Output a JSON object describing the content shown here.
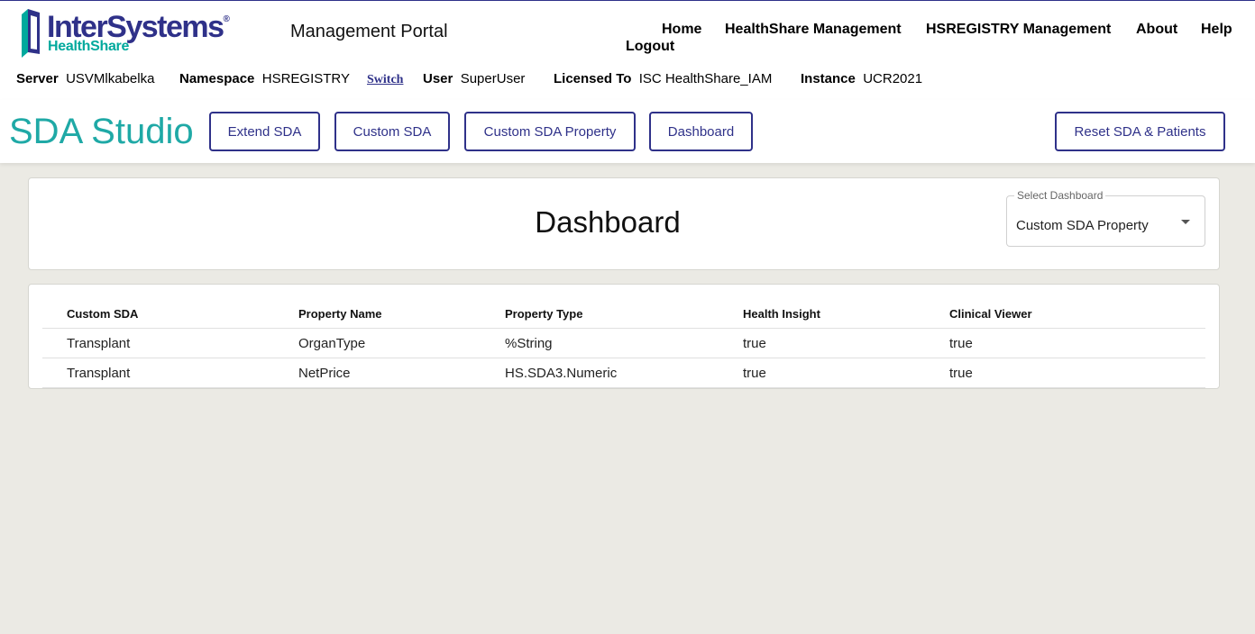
{
  "brand": {
    "name": "InterSystems",
    "registered": "®",
    "sub": "HealthShare",
    "colors": {
      "primary": "#2f3189",
      "accent": "#00a99d"
    }
  },
  "header": {
    "portal_title": "Management Portal",
    "nav": {
      "home": "Home",
      "healthshare": "HealthShare Management",
      "hsregistry": "HSREGISTRY Management",
      "about": "About",
      "help": "Help",
      "logout": "Logout"
    },
    "info": {
      "server_label": "Server",
      "server_value": "USVMlkabelka",
      "namespace_label": "Namespace",
      "namespace_value": "HSREGISTRY",
      "switch": "Switch",
      "user_label": "User",
      "user_value": "SuperUser",
      "licensed_label": "Licensed To",
      "licensed_value": "ISC HealthShare_IAM",
      "instance_label": "Instance",
      "instance_value": "UCR2021"
    }
  },
  "studio": {
    "title": "SDA Studio",
    "title_color": "#1fa9a6",
    "buttons": {
      "extend": "Extend SDA",
      "custom_sda": "Custom SDA",
      "custom_property": "Custom SDA Property",
      "dashboard": "Dashboard",
      "reset": "Reset SDA & Patients"
    }
  },
  "dashboard": {
    "heading": "Dashboard",
    "select_label": "Select Dashboard",
    "select_value": "Custom SDA Property",
    "select_icon": "caret-down-icon"
  },
  "table": {
    "headers": [
      "Custom SDA",
      "Property Name",
      "Property Type",
      "Health Insight",
      "Clinical Viewer"
    ],
    "rows": [
      [
        "Transplant",
        "OrganType",
        "%String",
        "true",
        "true"
      ],
      [
        "Transplant",
        "NetPrice",
        "HS.SDA3.Numeric",
        "true",
        "true"
      ]
    ]
  }
}
